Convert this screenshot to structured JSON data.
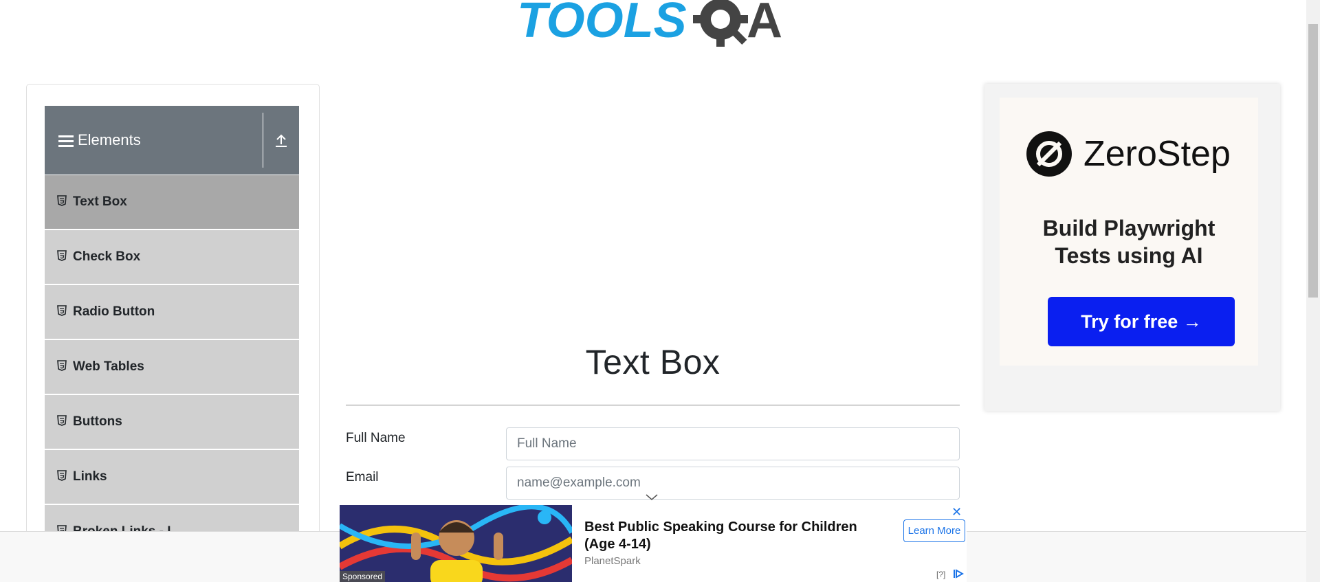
{
  "header": {
    "logo_text": "TOOLSQA"
  },
  "sidebar": {
    "group_title": "Elements",
    "items": [
      {
        "label": "Text Box",
        "active": true
      },
      {
        "label": "Check Box"
      },
      {
        "label": "Radio Button"
      },
      {
        "label": "Web Tables"
      },
      {
        "label": "Buttons"
      },
      {
        "label": "Links"
      },
      {
        "label": "Broken Links - I"
      }
    ]
  },
  "main": {
    "title": "Text Box",
    "fields": [
      {
        "label": "Full Name",
        "placeholder": "Full Name"
      },
      {
        "label": "Email",
        "placeholder": "name@example.com"
      }
    ]
  },
  "right_ad": {
    "brand": "ZeroStep",
    "tagline_line1": "Build Playwright",
    "tagline_line2": "Tests using AI",
    "cta": "Try for free →",
    "cta_color": "#0a1ff0"
  },
  "bottom_banner": {
    "sponsored": "Sponsored",
    "headline": "Best Public Speaking Course for Children (Age 4-14)",
    "advertiser": "PlanetSpark",
    "learn_more": "Learn More",
    "ad_info": "[?]"
  },
  "colors": {
    "sidebar_header": "#6c757d",
    "menu_item": "#d0d0d0",
    "menu_active": "#a8a8a8",
    "logo_blue": "#1ba1e2",
    "logo_dark": "#444"
  }
}
